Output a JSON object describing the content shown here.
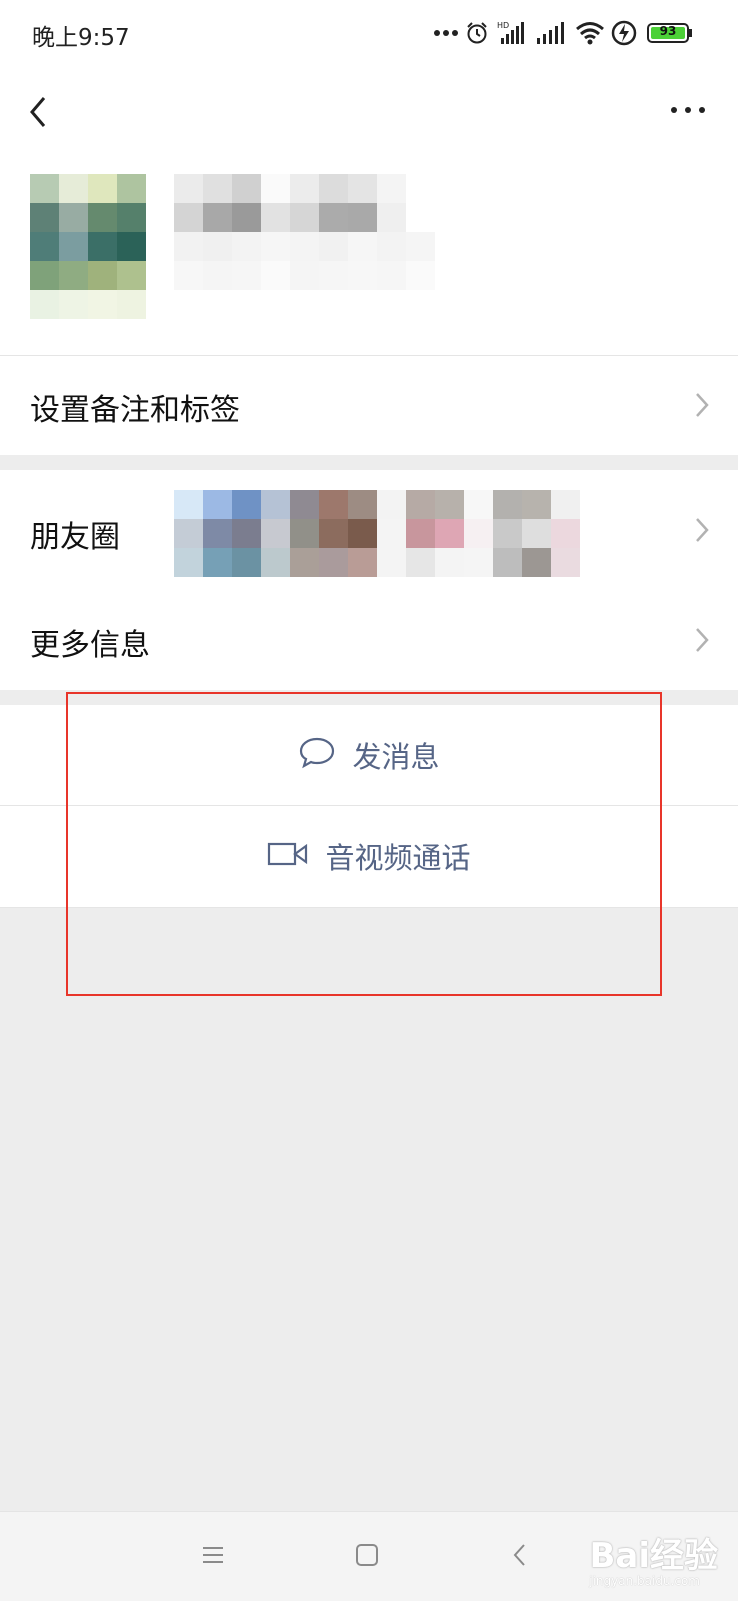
{
  "status_bar": {
    "time": "晚上9:57",
    "battery_level": "93",
    "network_badge": "HD",
    "icons": [
      "more-dots-icon",
      "alarm-icon",
      "signal-hd-icon",
      "signal-icon",
      "wifi-icon",
      "charging-icon",
      "battery-icon"
    ]
  },
  "header": {
    "back_icon": "back-arrow-icon",
    "more_icon": "more-options-icon"
  },
  "rows": {
    "remark": "设置备注和标签",
    "moments": "朋友圈",
    "more_info": "更多信息"
  },
  "actions": {
    "message": "发消息",
    "message_icon": "chat-bubble-icon",
    "call": "音视频通话",
    "call_icon": "video-camera-icon"
  },
  "nav_bar": {
    "icons": [
      "menu-icon",
      "home-icon",
      "back-icon"
    ]
  },
  "watermark": {
    "brand": "Bai经验",
    "url": "jingyan.baidu.com"
  },
  "colors": {
    "accent_link": "#566586",
    "highlight_box": "#e8352a",
    "battery_fill": "#4cd137",
    "background": "#ededed"
  }
}
